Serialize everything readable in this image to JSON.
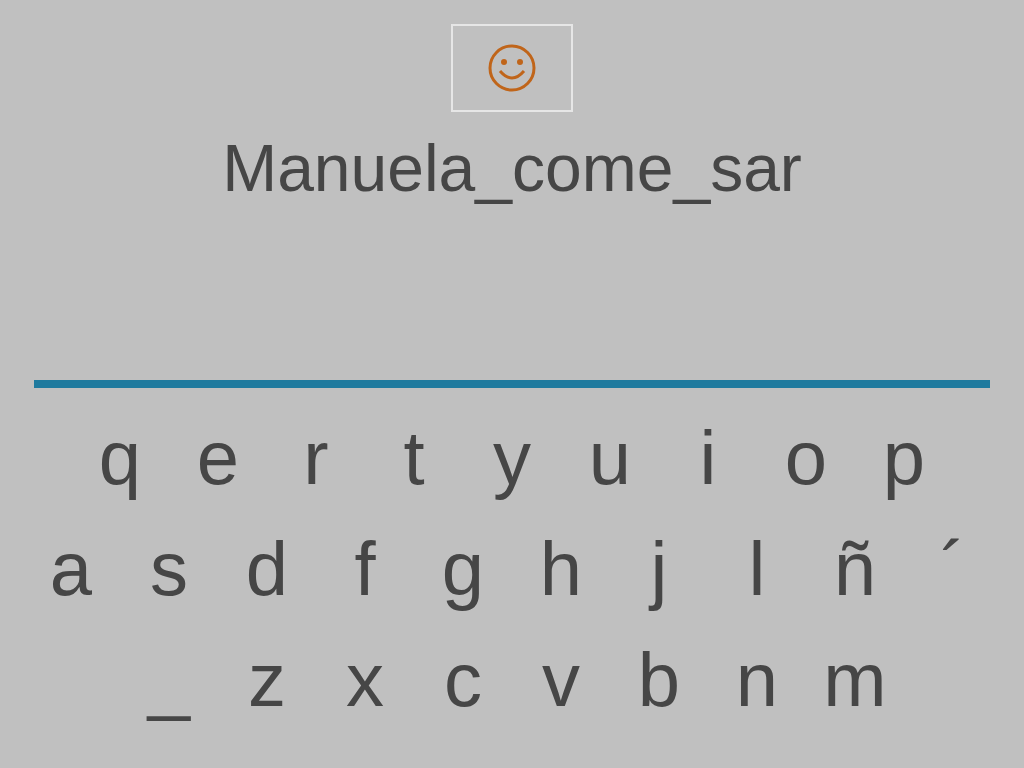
{
  "phrase": "Manuela_come_sar",
  "keyboard": {
    "rows": [
      [
        "q",
        "e",
        "r",
        "t",
        "y",
        "u",
        "i",
        "o",
        "p"
      ],
      [
        "a",
        "s",
        "d",
        "f",
        "g",
        "h",
        "j",
        "l",
        "ñ",
        "´"
      ],
      [
        "_",
        "z",
        "x",
        "c",
        "v",
        "b",
        "n",
        "m"
      ]
    ]
  }
}
